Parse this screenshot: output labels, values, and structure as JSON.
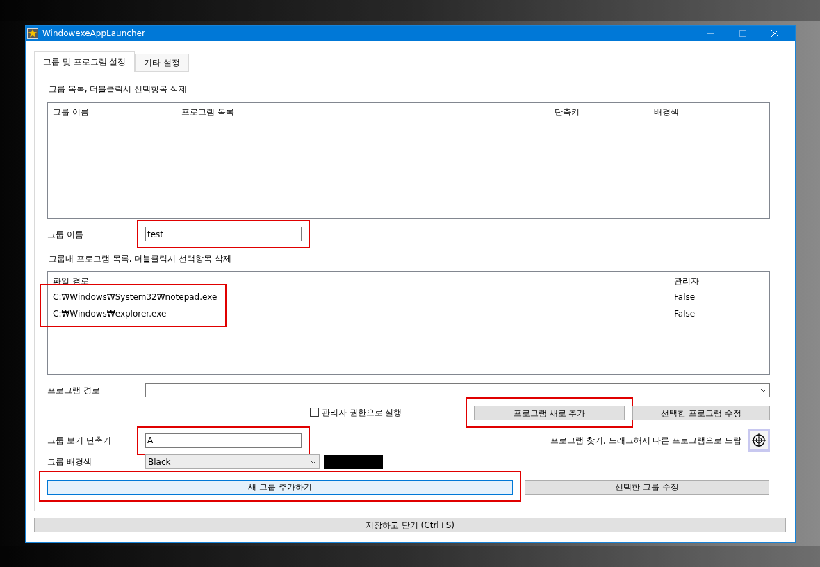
{
  "window": {
    "title": "WindowexeAppLauncher"
  },
  "tabs": [
    {
      "label": "그룹 및 프로그램 설정",
      "selected": true
    },
    {
      "label": "기타 설정",
      "selected": false
    }
  ],
  "group_list": {
    "caption": "그룹 목록, 더블클릭시 선택항목 삭제",
    "columns": [
      "그룹 이름",
      "프로그램 목록",
      "단축키",
      "배경색"
    ]
  },
  "group_name": {
    "label": "그룹 이름",
    "value": "test",
    "highlighted": true
  },
  "program_list": {
    "caption": "그룹내 프로그램 목록, 더블클릭시 선택항목 삭제",
    "columns": [
      "파일 경로",
      "관리자"
    ],
    "paths_highlighted": true,
    "rows": [
      {
        "path": "C:₩Windows₩System32₩notepad.exe",
        "admin": "False"
      },
      {
        "path": "C:₩Windows₩explorer.exe",
        "admin": "False"
      }
    ]
  },
  "program_path": {
    "label": "프로그램 경로"
  },
  "run_as_admin": {
    "label": "관리자 권한으로 실행",
    "checked": false
  },
  "program_buttons": [
    {
      "label": "프로그램 새로 추가",
      "highlighted": true
    },
    {
      "label": "선택한 프로그램 수정",
      "highlighted": false
    }
  ],
  "shortcut": {
    "label": "그룹 보기 단축키",
    "value": "A",
    "highlighted": true
  },
  "finder": {
    "label": "프로그램 찾기, 드래그해서 다른 프로그램으로 드랍"
  },
  "background": {
    "label": "그룹 배경색",
    "value": "Black",
    "color": "#000000"
  },
  "group_buttons": [
    {
      "label": "새 그룹 추가하기",
      "hovered": true,
      "highlighted": true
    },
    {
      "label": "선택한 그룹 수정",
      "hovered": false,
      "highlighted": false
    }
  ],
  "save_button": {
    "label": "저장하고 닫기 (Ctrl+S)"
  }
}
